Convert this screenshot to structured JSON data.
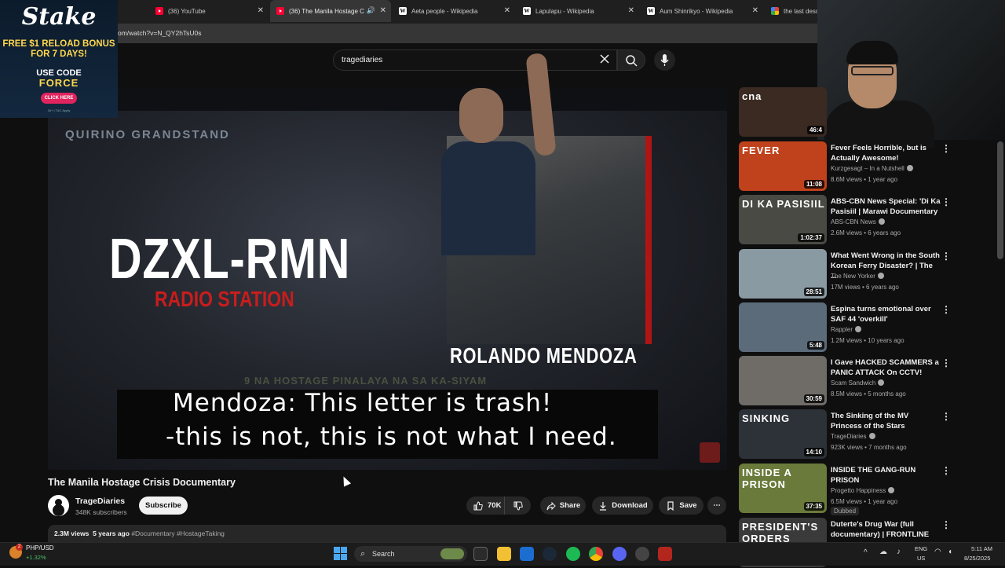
{
  "browser": {
    "tabs": [
      {
        "title": "(36) YouTube",
        "favicon": "youtube-icon",
        "active": false
      },
      {
        "title": "(36) The Manila Hostage C",
        "favicon": "youtube-icon",
        "active": true
      },
      {
        "title": "Aeta people - Wikipedia",
        "favicon": "wikipedia-icon",
        "active": false
      },
      {
        "title": "Lapulapu - Wikipedia",
        "favicon": "wikipedia-icon",
        "active": false
      },
      {
        "title": "Aum Shinrikyo - Wikipedia",
        "favicon": "wikipedia-icon",
        "active": false
      },
      {
        "title": "the last desc",
        "favicon": "google-icon",
        "active": false
      }
    ],
    "url": "om/watch?v=N_QY2hTsU0s"
  },
  "search": {
    "query": "tragediaries"
  },
  "ad": {
    "logo": "Stake",
    "line1": "FREE $1 RELOAD BONUS FOR 7 DAYS!",
    "line2": "USE CODE",
    "line3": "FORCE",
    "cta": "CLICK HERE",
    "fineprint": "18+ | T&C Apply"
  },
  "video_frame": {
    "location_sign": "QUIRINO GRANDSTAND",
    "callsign": "DZXL-RMN",
    "station": "RADIO STATION",
    "person_name": "ROLANDO MENDOZA",
    "ticker": "9 NA HOSTAGE PINALAYA NA SA KA-SIYAM",
    "caption_line1": "Mendoza: This letter is trash!",
    "caption_line2": "-this is not, this is not what I need."
  },
  "video": {
    "title": "The Manila Hostage Crisis Documentary",
    "channel": "TrageDiaries",
    "subscribers": "348K subscribers",
    "subscribe_label": "Subscribe",
    "likes": "70K",
    "share_label": "Share",
    "download_label": "Download",
    "save_label": "Save",
    "views": "2.3M views",
    "age": "5 years ago",
    "tags": "#Documentary #HostageTaking"
  },
  "recommendations": [
    {
      "title": "",
      "channel": "",
      "meta": "",
      "duration": "46:4",
      "thumb_label": "cna",
      "thumb_color": "#3a2a22"
    },
    {
      "title": "Fever Feels Horrible, but is Actually Awesome!",
      "channel": "Kurzgesagt – In a Nutshell",
      "meta": "8.6M views • 1 year ago",
      "duration": "11:08",
      "thumb_label": "FEVER",
      "thumb_color": "#c0421c"
    },
    {
      "title": "ABS-CBN News Special: 'Di Ka Pasisiil | Marawi Documentary",
      "channel": "ABS-CBN News",
      "meta": "2.6M views • 6 years ago",
      "duration": "1:02:37",
      "thumb_label": "DI KA PASISIIL",
      "thumb_color": "#4a4a44"
    },
    {
      "title": "What Went Wrong in the South Korean Ferry Disaster? | The ...",
      "channel": "The New Yorker",
      "meta": "17M views • 6 years ago",
      "duration": "28:51",
      "thumb_label": "",
      "thumb_color": "#8a9aa3"
    },
    {
      "title": "Espina turns emotional over SAF 44 'overkill'",
      "channel": "Rappler",
      "meta": "1.2M views • 10 years ago",
      "duration": "5:48",
      "thumb_label": "",
      "thumb_color": "#5b6b7a"
    },
    {
      "title": "I Gave HACKED SCAMMERS a PANIC ATTACK On CCTV!",
      "channel": "Scam Sandwich",
      "meta": "8.5M views • 5 months ago",
      "duration": "30:59",
      "thumb_label": "",
      "thumb_color": "#6f6c67"
    },
    {
      "title": "The Sinking of the MV Princess of the Stars",
      "channel": "TrageDiaries",
      "meta": "923K views • 7 months ago",
      "duration": "14:10",
      "thumb_label": "SINKING",
      "thumb_color": "#2d3238"
    },
    {
      "title": "INSIDE THE GANG-RUN PRISON",
      "channel": "Progetto Happiness",
      "meta": "6.5M views • 1 year ago",
      "badge": "Dubbed",
      "duration": "37:35",
      "thumb_label": "INSIDE A PRISON",
      "thumb_color": "#6a7a3a"
    },
    {
      "title": "Duterte's Drug War (full documentary) | FRONTLINE",
      "channel": "",
      "meta": "",
      "duration": "",
      "thumb_label": "PRESIDENT'S ORDERS",
      "thumb_color": "#3a3a3a"
    }
  ],
  "taskbar": {
    "ticker_pair": "PHP/USD",
    "ticker_change": "+1.32%",
    "ticker_badge": "2",
    "search_label": "Search",
    "lang1": "ENG",
    "lang2": "US",
    "time": "5:11 AM",
    "date": "8/25/2025"
  }
}
